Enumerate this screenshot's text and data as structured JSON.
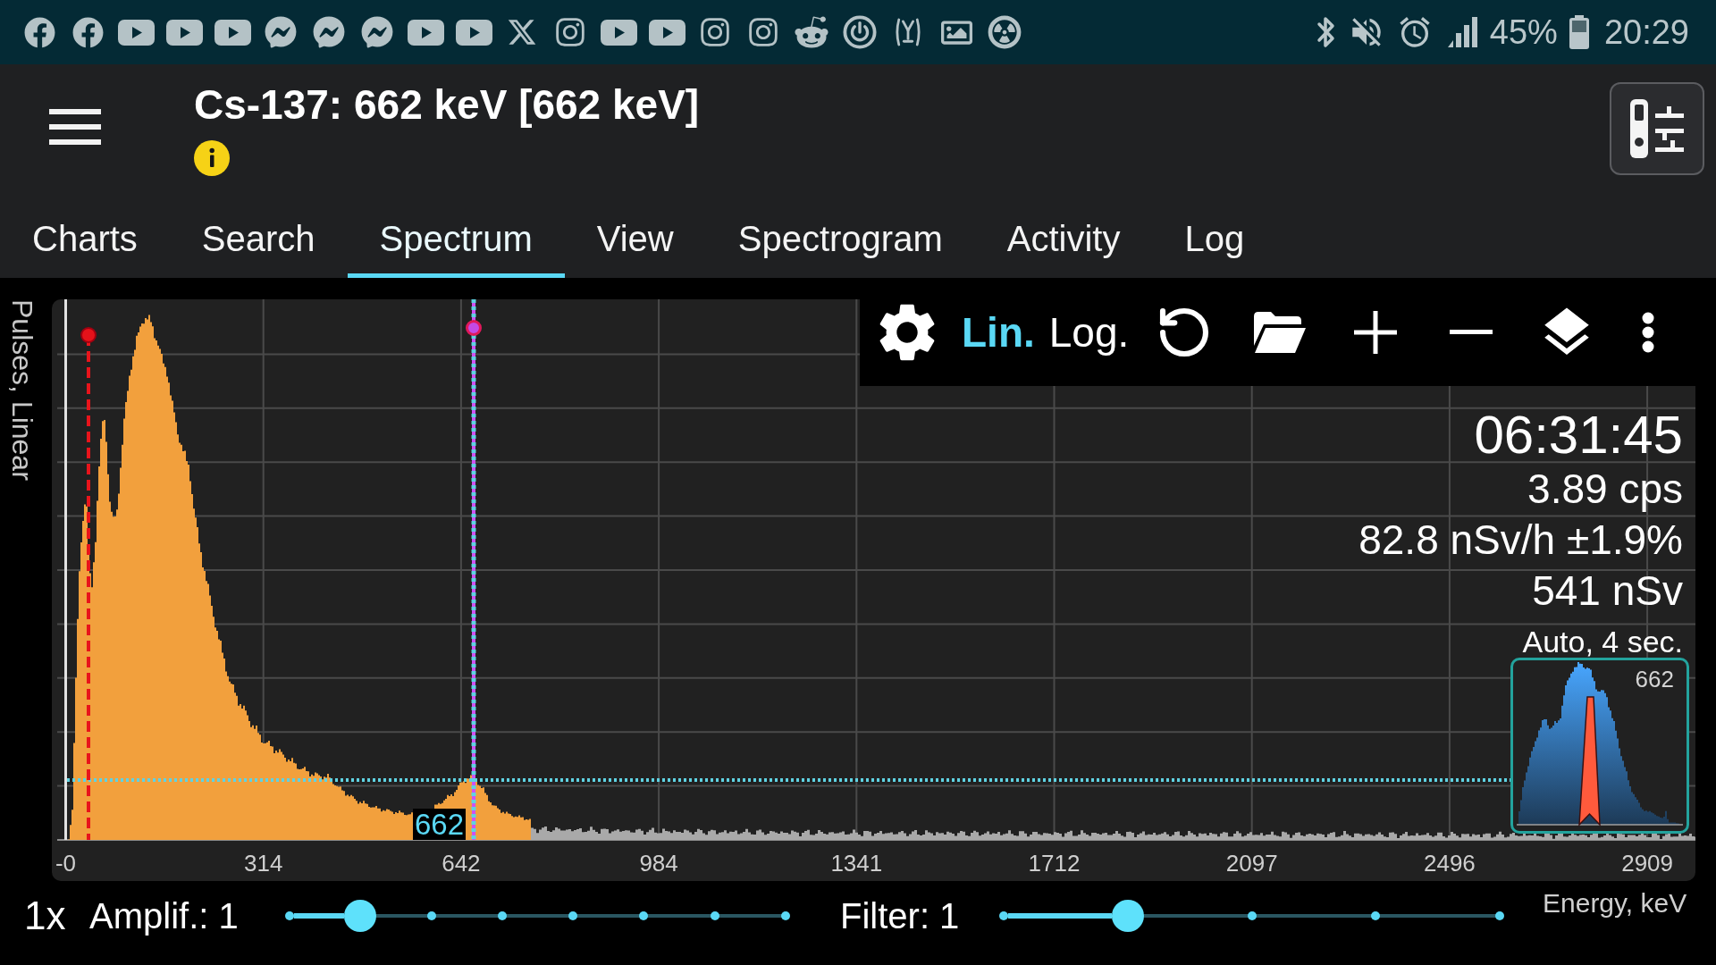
{
  "status_bar": {
    "battery": "45%",
    "time": "20:29"
  },
  "header": {
    "title": "Cs-137: 662 keV [662 keV]"
  },
  "tabs": [
    {
      "label": "Charts",
      "selected": false
    },
    {
      "label": "Search",
      "selected": false
    },
    {
      "label": "Spectrum",
      "selected": true
    },
    {
      "label": "View",
      "selected": false
    },
    {
      "label": "Spectrogram",
      "selected": false
    },
    {
      "label": "Activity",
      "selected": false
    },
    {
      "label": "Log",
      "selected": false
    }
  ],
  "spectrum": {
    "y_axis_label": "Pulses, Linear",
    "scale_modes": [
      {
        "label": "Lin.",
        "selected": true
      },
      {
        "label": "Log.",
        "selected": false
      }
    ],
    "readings": {
      "elapsed_time": "06:31:45",
      "count_rate": "3.89 cps",
      "dose_rate": "82.8 nSv/h ±1.9%",
      "dose": "541 nSv",
      "averaging": "Auto, 4 sec."
    },
    "peak_preview": {
      "label": "662"
    },
    "cursor_label": "662",
    "x_tick_labels": [
      "-0",
      "314",
      "642",
      "984",
      "1341",
      "1712",
      "2097",
      "2496",
      "2909"
    ],
    "x_axis_label": "Energy, keV"
  },
  "controls": {
    "zoom": "1x",
    "sliders": [
      {
        "label": "Amplif.: 1",
        "level": 0.1429
      },
      {
        "label": "Filter: 1",
        "level": 0.25
      }
    ]
  }
}
